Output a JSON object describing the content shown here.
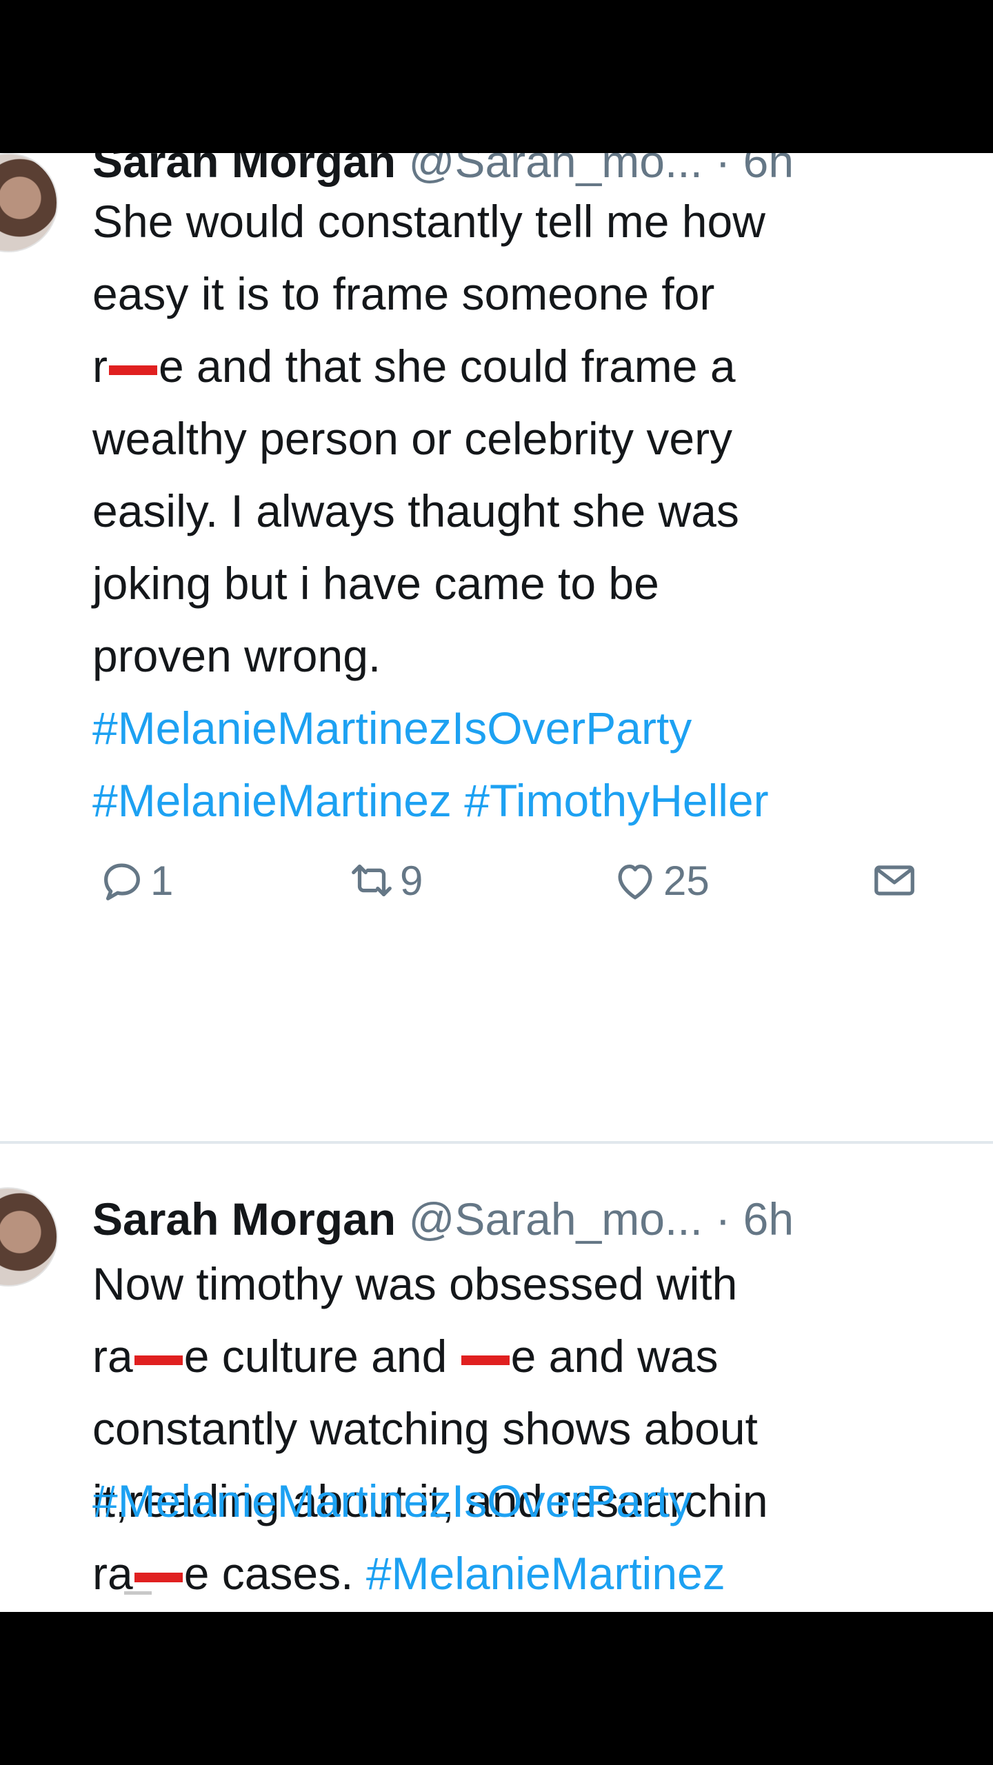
{
  "colors": {
    "background": "#000000",
    "card": "#ffffff",
    "text": "#14171a",
    "muted": "#657786",
    "link": "#1da1f2",
    "censor": "#e02020",
    "divider": "#e1e8ed"
  },
  "tweets": [
    {
      "name": "Sarah Morgan",
      "handle": "@Sarah_mo...",
      "separator": "·",
      "time": "6h",
      "body_line1": "She would constantly tell me how",
      "body_line2": "easy it is to frame someone for",
      "body_line3_a": "r",
      "body_line3_b": "e and that she could frame a",
      "body_line4": "wealthy person or celebrity very",
      "body_line5": "easily. I always thaught she was",
      "body_line6": "joking but i have came to be",
      "body_line7": "proven wrong.",
      "hashtag_1": "#MelanieMartinezIsOverParty",
      "hashtag_2": "#MelanieMartinez #TimothyHeller",
      "actions": {
        "reply_count": "1",
        "retweet_count": "9",
        "like_count": "25"
      },
      "icons": [
        "reply-icon",
        "retweet-icon",
        "like-icon",
        "mail-icon"
      ]
    },
    {
      "name": "Sarah Morgan",
      "handle": "@Sarah_mo...",
      "separator": "·",
      "time": "6h",
      "body_line1": "Now timothy was obsessed with",
      "body_line2_a": "ra",
      "body_line2_b": "e culture and ",
      "body_line2_c": "e and was",
      "body_line3": "constantly watching shows about",
      "body_line4": "it,reading about it, and researchin",
      "body_line5_a": "ra",
      "body_line5_b": "e cases. ",
      "body_line5_tag": "#MelanieMartinez",
      "hashtag_1": "#MelanieMartinezIsOverParty"
    }
  ]
}
